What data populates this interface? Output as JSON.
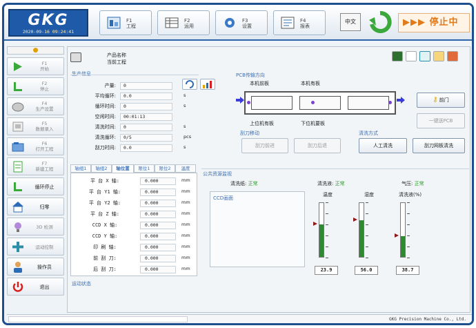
{
  "header": {
    "logo": "GKG",
    "datetime": "2020-09-16 09:24:41",
    "buttons": [
      {
        "line1": "F1",
        "line2": "工程"
      },
      {
        "line1": "F2",
        "line2": "运用"
      },
      {
        "line1": "F3",
        "line2": "设置"
      },
      {
        "line1": "F4",
        "line2": "报表"
      }
    ],
    "language": "中文",
    "run_status": "▶▶▶ 停止中",
    "status_color": "#e07a1a"
  },
  "sidebar": {
    "items": [
      {
        "key": "F1",
        "label": "开始",
        "icon": "play-icon"
      },
      {
        "key": "F2",
        "label": "停止",
        "icon": "stop-icon"
      },
      {
        "key": "F4",
        "label": "生产设置",
        "icon": "settings-icon"
      },
      {
        "key": "F5",
        "label": "数据录入",
        "icon": "data-entry-icon"
      },
      {
        "key": "F6",
        "label": "打开工程",
        "icon": "open-project-icon"
      },
      {
        "key": "F7",
        "label": "新建工程",
        "icon": "new-project-icon"
      },
      {
        "key": "",
        "label": "循环停止",
        "icon": "cycle-stop-icon"
      },
      {
        "key": "",
        "label": "归零",
        "icon": "home-icon"
      },
      {
        "key": "",
        "label": "3D 检测",
        "icon": "bulb-icon"
      },
      {
        "key": "",
        "label": "运动控制",
        "icon": "motion-icon"
      },
      {
        "key": "",
        "label": "操作员",
        "icon": "operator-icon"
      },
      {
        "key": "",
        "label": "退出",
        "icon": "power-icon"
      }
    ]
  },
  "program": {
    "name_label": "产品名称",
    "current_label": "当前工程"
  },
  "production": {
    "title": "生产信息",
    "rows": [
      {
        "label": "产量:",
        "value": "0",
        "unit": ""
      },
      {
        "label": "平均循环:",
        "value": "0.0",
        "unit": "s"
      },
      {
        "label": "循环时间:",
        "value": "0",
        "unit": "s"
      },
      {
        "label": "空闲时间:",
        "value": "00:01:13",
        "unit": ""
      },
      {
        "label": "清洗时间:",
        "value": "0",
        "unit": "s"
      },
      {
        "label": "清洗循环:",
        "value": "0/5",
        "unit": "pcs"
      },
      {
        "label": "刮刀时间:",
        "value": "0.0",
        "unit": "s"
      }
    ]
  },
  "pcb": {
    "title": "PCB传输方向",
    "label_front_entry": "本机前板",
    "label_front_board": "本机有板",
    "label_upper": "上位机有板",
    "label_lower": "下位机要板",
    "door_label": "前门",
    "feed_label": "一键送PCB",
    "blade_title": "刮刀移动",
    "blade_front": "刮刀前进",
    "blade_back": "刮刀后退",
    "clean_title": "清洗方式",
    "manual_clean": "人工清洗",
    "auto_clean": "刮刀网板清洗"
  },
  "axis": {
    "tabs": [
      "轴组1",
      "轴组2",
      "轴位置",
      "限位1",
      "限位2",
      "温度"
    ],
    "active_tab": 2,
    "rows": [
      {
        "name": "平 台 X  轴:",
        "value": "0.000",
        "unit": "mm"
      },
      {
        "name": "平 台 Y1 轴:",
        "value": "0.000",
        "unit": "mm"
      },
      {
        "name": "平 台 Y2 轴:",
        "value": "0.000",
        "unit": "mm"
      },
      {
        "name": "平 台 Z  轴:",
        "value": "0.000",
        "unit": "mm"
      },
      {
        "name": "CCD  X  轴:",
        "value": "0.000",
        "unit": "mm"
      },
      {
        "name": "CCD  Y  轴:",
        "value": "0.000",
        "unit": "mm"
      },
      {
        "name": "印  刷  轴:",
        "value": "0.000",
        "unit": "mm"
      },
      {
        "name": "前  刮  刀:",
        "value": "0.000",
        "unit": "mm"
      },
      {
        "name": "后  刮  刀:",
        "value": "0.000",
        "unit": "mm"
      }
    ]
  },
  "monitor": {
    "title": "公共资源监视",
    "ccd_label": "CCD画面",
    "cleaning_label": "清洗纸:",
    "cleaning_state": "正常",
    "solvent_label": "清洗液:",
    "solvent_state": "正常",
    "air_label": "气压:",
    "air_state": "正常",
    "gauges": [
      {
        "title": "温度",
        "value": "23.9",
        "level": 0.6
      },
      {
        "title": "湿度",
        "value": "56.0",
        "level": 0.68
      },
      {
        "title": "清洗液(%)",
        "value": "38.7",
        "level": 0.39
      }
    ],
    "state_color": "#2e9e2e"
  },
  "motion_status": "运动状态",
  "footer": {
    "copyright": "GKG Precision Machine Co., Ltd."
  }
}
